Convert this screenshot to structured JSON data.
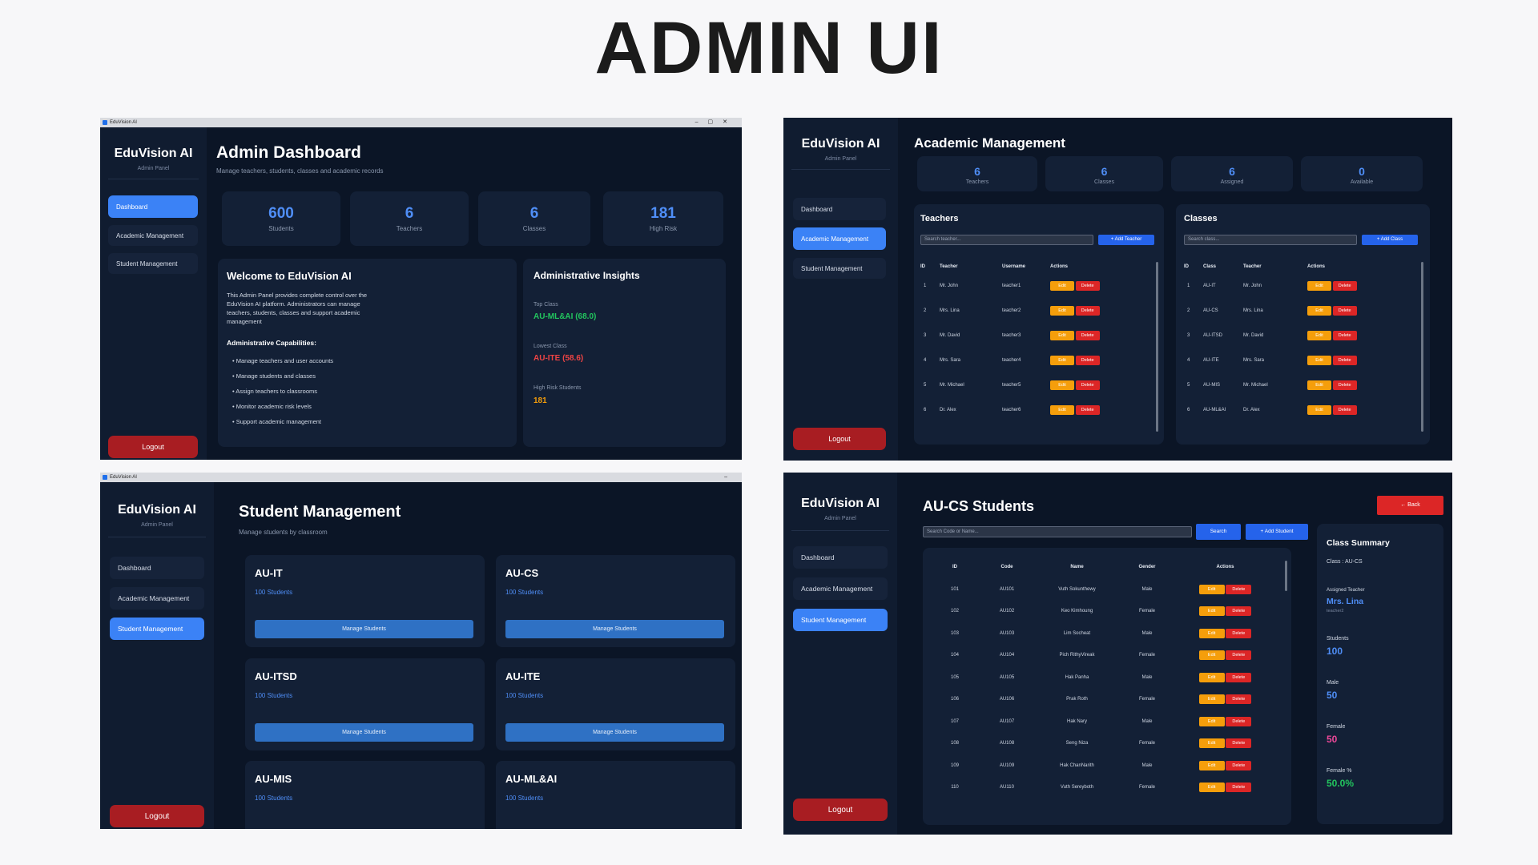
{
  "page_title": "ADMIN UI",
  "colors": {
    "accent": "#3b82f6",
    "panel_bg": "#0b1526",
    "danger": "#dc2626",
    "warning": "#f59e0b",
    "success": "#22c55e",
    "pink": "#ec4899"
  },
  "window": {
    "title": "EduVision AI"
  },
  "sidebar": {
    "brand": "EduVision AI",
    "subtitle": "Admin Panel",
    "items": [
      "Dashboard",
      "Academic Management",
      "Student Management"
    ],
    "logout": "Logout"
  },
  "dashboard": {
    "title": "Admin Dashboard",
    "subtitle": "Manage teachers, students, classes and academic records",
    "stats": [
      {
        "value": "600",
        "label": "Students"
      },
      {
        "value": "6",
        "label": "Teachers"
      },
      {
        "value": "6",
        "label": "Classes"
      },
      {
        "value": "181",
        "label": "High Risk"
      }
    ],
    "welcome": {
      "title": "Welcome to EduVision AI",
      "text": "This Admin Panel provides complete control over the EduVision AI platform. Administrators can manage teachers, students, classes and support academic management",
      "capabilities_title": "Administrative Capabilities:",
      "capabilities": [
        "• Manage teachers and user accounts",
        "• Manage students and classes",
        "• Assign teachers to classrooms",
        "• Monitor academic risk levels",
        "• Support academic management"
      ]
    },
    "insights": {
      "title": "Administrative Insights",
      "top_label": "Top Class",
      "top_value": "AU-ML&AI (68.0)",
      "low_label": "Lowest Class",
      "low_value": "AU-ITE (58.6)",
      "risk_label": "High Risk Students",
      "risk_value": "181"
    }
  },
  "academic": {
    "title": "Academic Management",
    "stats": [
      {
        "value": "6",
        "label": "Teachers"
      },
      {
        "value": "6",
        "label": "Classes"
      },
      {
        "value": "6",
        "label": "Assigned"
      },
      {
        "value": "0",
        "label": "Available"
      }
    ],
    "teachers": {
      "title": "Teachers",
      "search_placeholder": "Search teacher...",
      "add_label": "+ Add Teacher",
      "columns": [
        "ID",
        "Teacher",
        "Username",
        "Actions"
      ],
      "rows": [
        [
          "1",
          "Mr. John",
          "teacher1"
        ],
        [
          "2",
          "Mrs. Lina",
          "teacher2"
        ],
        [
          "3",
          "Mr. David",
          "teacher3"
        ],
        [
          "4",
          "Mrs. Sara",
          "teacher4"
        ],
        [
          "5",
          "Mr. Michael",
          "teacher5"
        ],
        [
          "6",
          "Dr. Alex",
          "teacher6"
        ]
      ]
    },
    "classes": {
      "title": "Classes",
      "search_placeholder": "Search class...",
      "add_label": "+ Add Class",
      "columns": [
        "ID",
        "Class",
        "Teacher",
        "Actions"
      ],
      "rows": [
        [
          "1",
          "AU-IT",
          "Mr. John"
        ],
        [
          "2",
          "AU-CS",
          "Mrs. Lina"
        ],
        [
          "3",
          "AU-ITSD",
          "Mr. David"
        ],
        [
          "4",
          "AU-ITE",
          "Mrs. Sara"
        ],
        [
          "5",
          "AU-MIS",
          "Mr. Michael"
        ],
        [
          "6",
          "AU-ML&AI",
          "Dr. Alex"
        ]
      ]
    },
    "edit_label": "Edit",
    "delete_label": "Delete"
  },
  "student_mgmt": {
    "title": "Student Management",
    "subtitle": "Manage students by classroom",
    "manage_label": "Manage Students",
    "classes": [
      {
        "name": "AU-IT",
        "count": "100 Students"
      },
      {
        "name": "AU-CS",
        "count": "100 Students"
      },
      {
        "name": "AU-ITSD",
        "count": "100 Students"
      },
      {
        "name": "AU-ITE",
        "count": "100 Students"
      },
      {
        "name": "AU-MIS",
        "count": "100 Students"
      },
      {
        "name": "AU-ML&AI",
        "count": "100 Students"
      }
    ]
  },
  "class_students": {
    "title": "AU-CS Students",
    "back_label": "← Back",
    "search_placeholder": "Search Code or Name...",
    "search_label": "Search",
    "add_label": "+ Add Student",
    "columns": [
      "ID",
      "Code",
      "Name",
      "Gender",
      "Actions"
    ],
    "rows": [
      [
        "101",
        "AU101",
        "Vuth Sokunthewy",
        "Male"
      ],
      [
        "102",
        "AU102",
        "Keo Kimhoung",
        "Female"
      ],
      [
        "103",
        "AU103",
        "Lim Socheat",
        "Male"
      ],
      [
        "104",
        "AU104",
        "Pich RithyVireak",
        "Female"
      ],
      [
        "105",
        "AU105",
        "Hak Panha",
        "Male"
      ],
      [
        "106",
        "AU106",
        "Prak Roth",
        "Female"
      ],
      [
        "107",
        "AU107",
        "Hak Nary",
        "Male"
      ],
      [
        "108",
        "AU108",
        "Seng Niza",
        "Female"
      ],
      [
        "109",
        "AU109",
        "Hak ChanNarith",
        "Male"
      ],
      [
        "110",
        "AU110",
        "Vuth Sereyboth",
        "Female"
      ]
    ],
    "summary": {
      "title": "Class Summary",
      "class_line": "Class : AU-CS",
      "teacher_label": "Assigned Teacher",
      "teacher_name": "Mrs. Lina",
      "teacher_user": "teacher2",
      "students_label": "Students",
      "students_value": "100",
      "male_label": "Male",
      "male_value": "50",
      "female_label": "Female",
      "female_value": "50",
      "pct_label": "Female %",
      "pct_value": "50.0%"
    }
  }
}
